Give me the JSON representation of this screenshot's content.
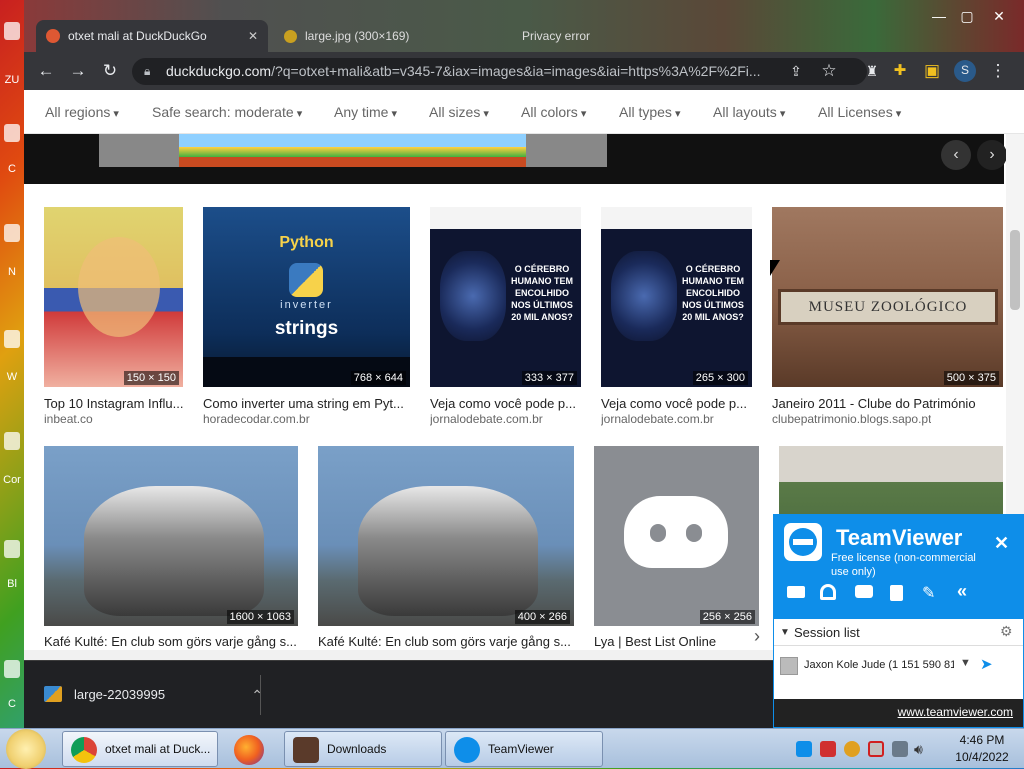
{
  "desktop": {
    "labels": [
      "ZU",
      "C",
      "N",
      "W",
      "Cor",
      "Bl",
      "C"
    ]
  },
  "browser": {
    "tabs": [
      {
        "title": "otxet mali at DuckDuckGo",
        "icon": "duckduckgo-icon"
      },
      {
        "title": "large.jpg (300×169)",
        "icon": "image-icon"
      },
      {
        "title": "Privacy error",
        "icon": "warning-icon"
      }
    ],
    "url_host": "duckduckgo.com",
    "url_rest": "/?q=otxet+mali&atb=v345-7&iax=images&ia=images&iai=https%3A%2F%2Fi..."
  },
  "filters": [
    "All regions",
    "Safe search: moderate",
    "Any time",
    "All sizes",
    "All colors",
    "All types",
    "All layouts",
    "All Licenses"
  ],
  "images_row1": [
    {
      "title": "Top 10 Instagram Influ...",
      "source": "inbeat.co",
      "dims": "150 × 150",
      "bg": "#d8c080"
    },
    {
      "title": "Como inverter uma string em Pyt...",
      "source": "horadecodar.com.br",
      "dims": "768 × 644",
      "bg": "#0d3a6e",
      "big_text": "Python",
      "sub_text": "inverter",
      "big_text2": "strings"
    },
    {
      "title": "Veja como você pode p...",
      "source": "jornalodebate.com.br",
      "dims": "333 × 377",
      "bg": "#0e1530",
      "headline": "O CÉREBRO HUMANO TEM ENCOLHIDO NOS ÚLTIMOS 20 MIL ANOS?"
    },
    {
      "title": "Veja como você pode p...",
      "source": "jornalodebate.com.br",
      "dims": "265 × 300",
      "bg": "#0e1530",
      "headline": "O CÉREBRO HUMANO TEM ENCOLHIDO NOS ÚLTIMOS 20 MIL ANOS?"
    },
    {
      "title": "Janeiro 2011 - Clube do Património",
      "source": "clubepatrimonio.blogs.sapo.pt",
      "dims": "500 × 375",
      "bg": "#8a6048",
      "sign": "MUSEU ZOOLÓGICO"
    }
  ],
  "images_row2": [
    {
      "title": "Kafé Kulté: En club som görs varje gång s...",
      "dims": "1600 × 1063",
      "bg": "#6a8fb8"
    },
    {
      "title": "Kafé Kulté: En club som görs varje gång s...",
      "dims": "400 × 266",
      "bg": "#6a8fb8"
    },
    {
      "title": "Lya | Best List Online",
      "dims": "256 × 256",
      "bg": "#8a8d92"
    },
    {
      "title": "",
      "dims": "",
      "bg": "#5a7a48"
    }
  ],
  "downloads": {
    "item": "large-22039995"
  },
  "teamviewer": {
    "title": "TeamViewer",
    "subtitle": "Free license (non-commercial use only)",
    "section": "Session list",
    "session": "Jaxon Kole Jude (1 151 590 81",
    "link": "www.teamviewer.com"
  },
  "taskbar": {
    "items": [
      "otxet mali at Duck...",
      "Downloads",
      "TeamViewer"
    ],
    "time": "4:46 PM",
    "date": "10/4/2022"
  },
  "colors": {
    "ddg_orange": "#de5833",
    "teamviewer_blue": "#0e8ee9",
    "chrome_dark": "#35363a"
  }
}
